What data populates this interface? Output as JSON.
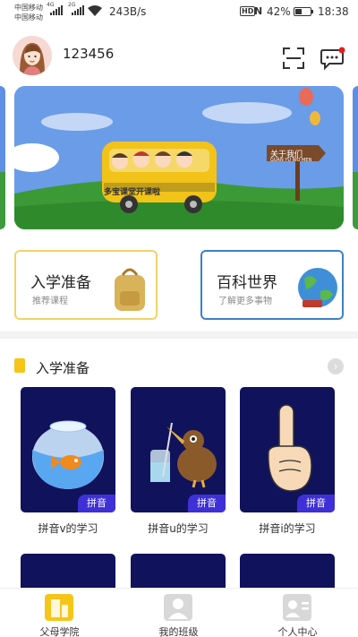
{
  "status_bar": {
    "carrier1": "中国移动",
    "carrier2": "中国移动",
    "net1": "4G",
    "net2": "2G",
    "speed": "243B/s",
    "hd": "HD",
    "nfc": "N",
    "battery_pct": "42%",
    "battery_level": 0.42,
    "time": "18:38"
  },
  "header": {
    "username": "123456",
    "icons": [
      "avatar",
      "scan-icon",
      "message-icon"
    ]
  },
  "banner": {
    "bus_text": "多宝课堂开课啦",
    "sign_text": "关于我们",
    "sign_sub": "GUAN YU WO MEN"
  },
  "feature_cards": [
    {
      "title": "入学准备",
      "subtitle": "推荐课程"
    },
    {
      "title": "百科世界",
      "subtitle": "了解更多事物"
    }
  ],
  "section": {
    "title": "入学准备",
    "more_icon": "chevron-right-icon"
  },
  "lessons": [
    {
      "label": "拼音v的学习",
      "tag": "拼音"
    },
    {
      "label": "拼音u的学习",
      "tag": "拼音"
    },
    {
      "label": "拼音i的学习",
      "tag": "拼音"
    }
  ],
  "tabs": [
    {
      "label": "父母学院",
      "active": true
    },
    {
      "label": "我的班级",
      "active": false
    },
    {
      "label": "个人中心",
      "active": false
    }
  ],
  "colors": {
    "accent_yellow": "#f5c518",
    "card_dark": "#11125c",
    "tag_purple": "#3e2fd6",
    "card_border_blue": "#3d7fc9"
  }
}
